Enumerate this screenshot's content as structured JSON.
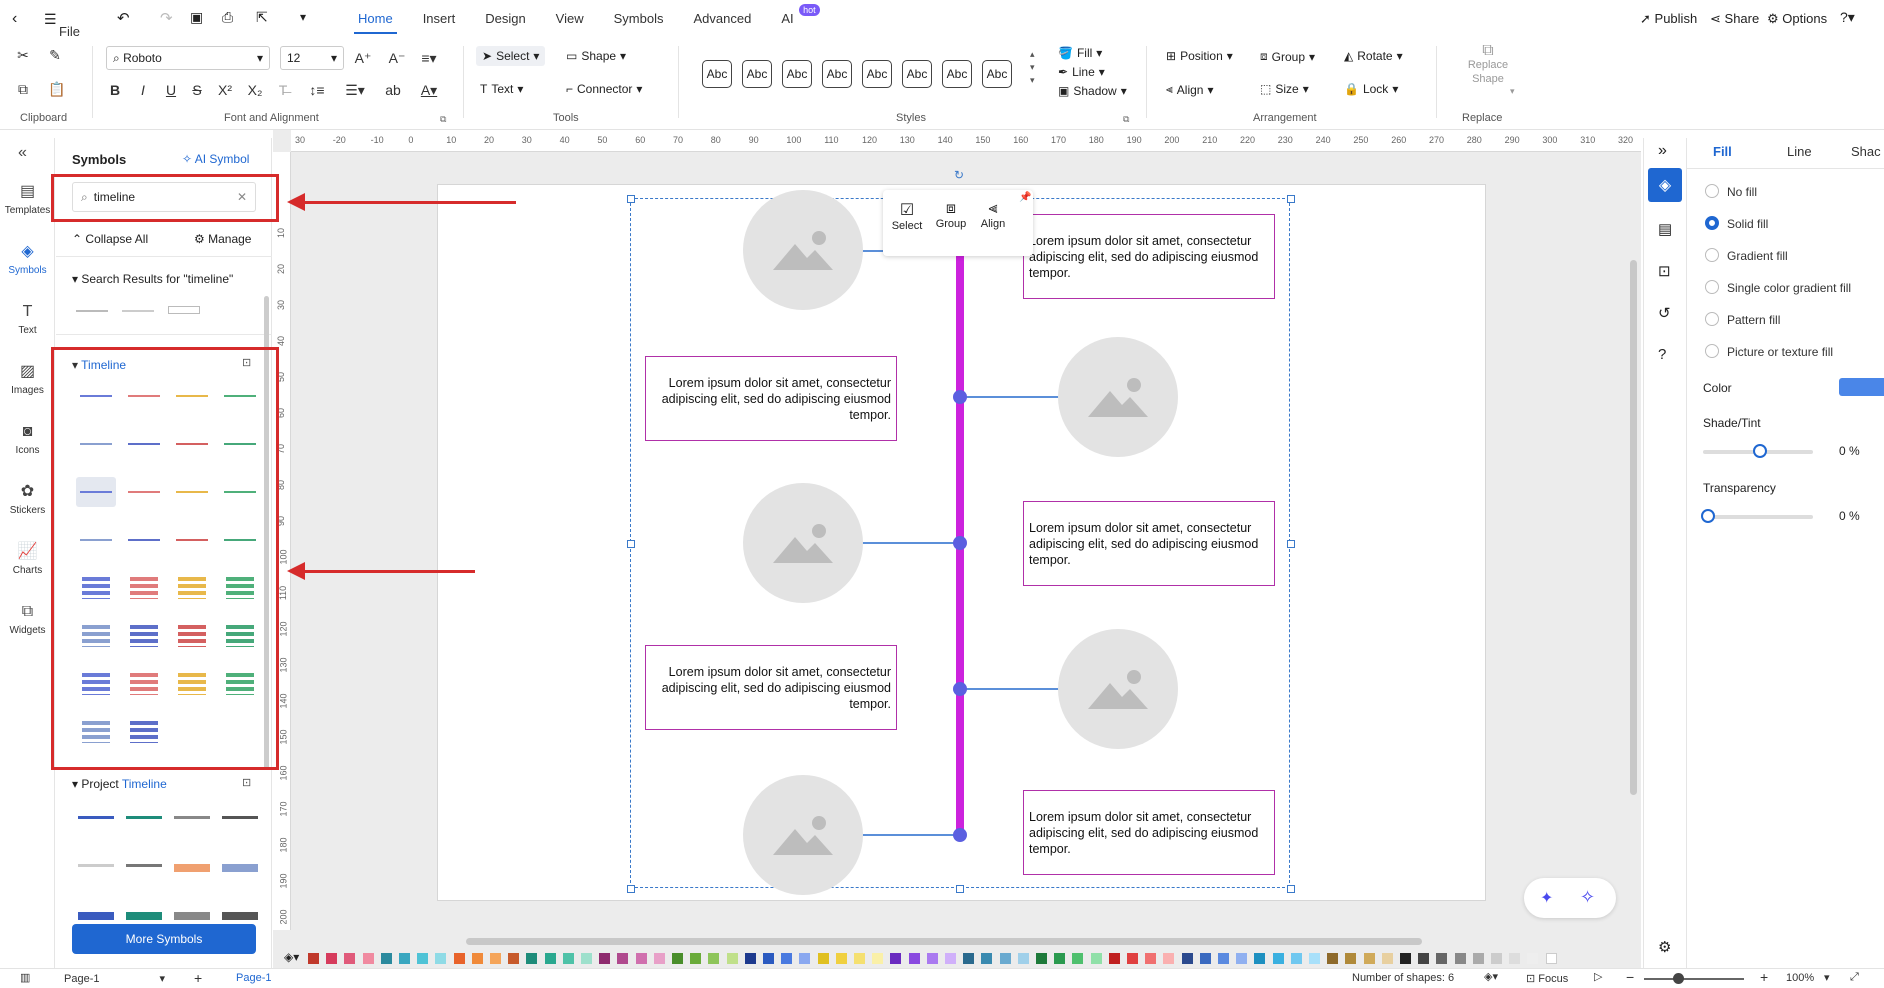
{
  "menubar": {
    "file": "File",
    "tabs": [
      {
        "label": "Home"
      },
      {
        "label": "Insert"
      },
      {
        "label": "Design"
      },
      {
        "label": "View"
      },
      {
        "label": "Symbols"
      },
      {
        "label": "Advanced"
      },
      {
        "label": "AI"
      }
    ],
    "hot_badge": "hot",
    "publish": "Publish",
    "share": "Share",
    "options": "Options"
  },
  "ribbon": {
    "font_name": "Roboto",
    "font_size": "12",
    "select": "Select",
    "shape": "Shape",
    "text": "Text",
    "connector": "Connector",
    "style_sample": "Abc",
    "fill": "Fill",
    "line": "Line",
    "shadow": "Shadow",
    "position": "Position",
    "group": "Group",
    "rotate": "Rotate",
    "align": "Align",
    "size": "Size",
    "lock": "Lock",
    "replace_shape_1": "Replace",
    "replace_shape_2": "Shape",
    "groups": {
      "clipboard": "Clipboard",
      "font": "Font and Alignment",
      "tools": "Tools",
      "styles": "Styles",
      "arrangement": "Arrangement",
      "replace": "Replace"
    }
  },
  "leftnav": [
    {
      "label": "Templates"
    },
    {
      "label": "Symbols"
    },
    {
      "label": "Text"
    },
    {
      "label": "Images"
    },
    {
      "label": "Icons"
    },
    {
      "label": "Stickers"
    },
    {
      "label": "Charts"
    },
    {
      "label": "Widgets"
    }
  ],
  "library": {
    "title": "Symbols",
    "ai_symbol": "AI Symbol",
    "search_value": "timeline",
    "collapse_all": "Collapse All",
    "manage": "Manage",
    "search_results": "Search Results for  \"timeline\"",
    "timeline_section": "Timeline",
    "project_prefix": "Project ",
    "project_highlight": "Timeline",
    "more_symbols": "More Symbols"
  },
  "floating_toolbar": {
    "select": "Select",
    "group": "Group",
    "align": "Align"
  },
  "canvas": {
    "lorem": "Lorem ipsum dolor sit amet, consectetur adipiscing elit, sed do adipiscing eiusmod tempor.",
    "ruler_h": [
      "30",
      "-20",
      "-10",
      "0",
      "10",
      "20",
      "30",
      "40",
      "50",
      "60",
      "70",
      "80",
      "90",
      "100",
      "110",
      "120",
      "130",
      "140",
      "150",
      "160",
      "170",
      "180",
      "190",
      "200",
      "210",
      "220",
      "230",
      "240",
      "250",
      "260",
      "270",
      "280",
      "290",
      "300",
      "310",
      "320"
    ],
    "ruler_v": [
      "10",
      "20",
      "30",
      "40",
      "50",
      "60",
      "70",
      "80",
      "90",
      "100",
      "110",
      "120",
      "130",
      "140",
      "150",
      "160",
      "170",
      "180",
      "190",
      "200"
    ]
  },
  "rpanel": {
    "tabs": [
      "Fill",
      "Line",
      "Shac"
    ],
    "options": [
      "No fill",
      "Solid fill",
      "Gradient fill",
      "Single color gradient fill",
      "Pattern fill",
      "Picture or texture fill"
    ],
    "color_label": "Color",
    "shade_label": "Shade/Tint",
    "shade_value": "0 %",
    "transparency_label": "Transparency",
    "transparency_value": "0 %",
    "accent": "#1f67d1"
  },
  "status": {
    "page_select": "Page-1",
    "page_tab": "Page-1",
    "shapes": "Number of shapes: 6",
    "focus": "Focus",
    "zoom": "100%"
  }
}
